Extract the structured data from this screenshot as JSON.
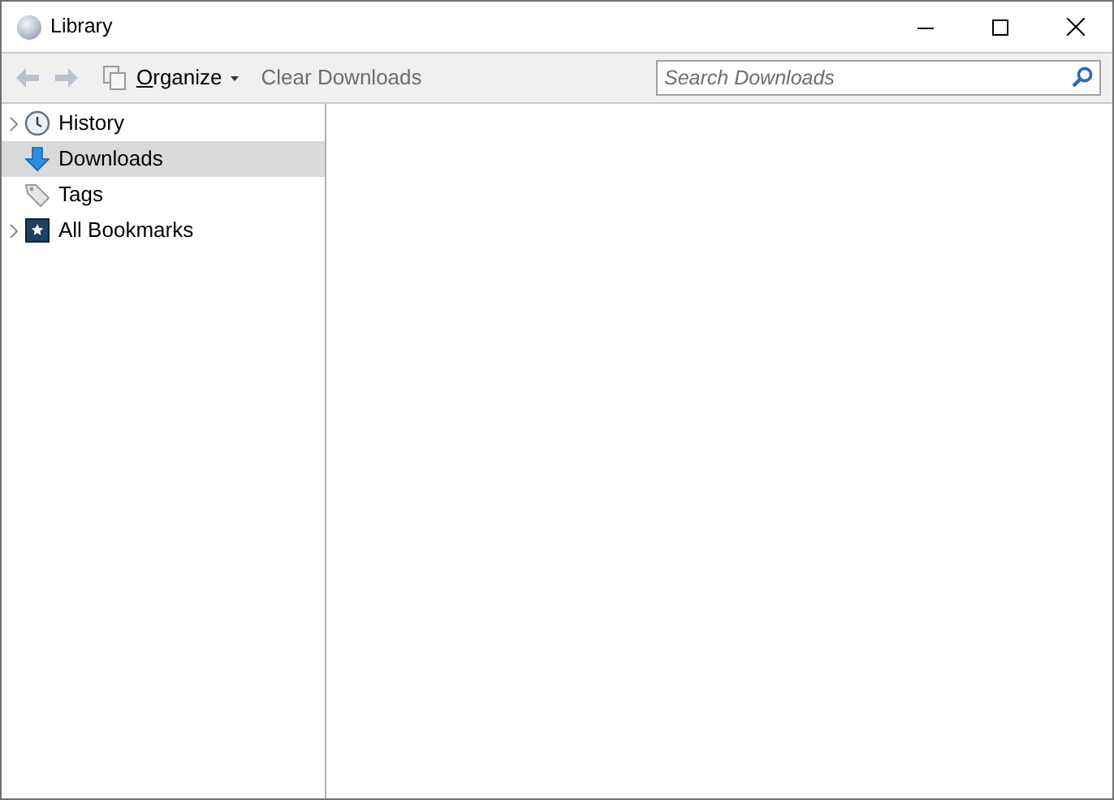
{
  "window": {
    "title": "Library"
  },
  "toolbar": {
    "organize": {
      "label": "Organize"
    },
    "clear_button": {
      "label": "Clear Downloads",
      "disabled": true
    },
    "search": {
      "placeholder": "Search Downloads"
    }
  },
  "sidebar": {
    "items": [
      {
        "kind": "history",
        "label": "History",
        "expandable": true,
        "selected": false
      },
      {
        "kind": "downloads",
        "label": "Downloads",
        "expandable": false,
        "selected": true
      },
      {
        "kind": "tags",
        "label": "Tags",
        "expandable": false,
        "selected": false
      },
      {
        "kind": "bookmarks",
        "label": "All Bookmarks",
        "expandable": true,
        "selected": false
      }
    ]
  }
}
